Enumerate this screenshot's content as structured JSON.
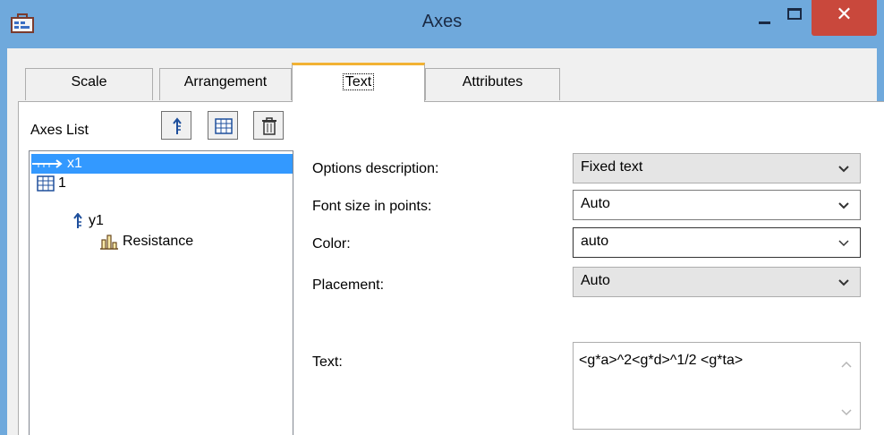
{
  "window": {
    "title": "Axes",
    "close_glyph": "✕"
  },
  "tabs": [
    {
      "label": "Scale"
    },
    {
      "label": "Arrangement"
    },
    {
      "label": "Text",
      "active": true
    },
    {
      "label": "Attributes"
    }
  ],
  "axes_list": {
    "label": "Axes List",
    "toolbar": [
      {
        "icon": "axis-y-icon"
      },
      {
        "icon": "grid-icon"
      },
      {
        "icon": "trash-icon"
      }
    ],
    "items": [
      {
        "label": "x1",
        "icon": "axis-x-icon",
        "selected": true
      },
      {
        "label": "1",
        "icon": "grid-icon"
      },
      {
        "label": "y1",
        "icon": "axis-y-icon"
      },
      {
        "label": "Resistance",
        "icon": "bar-chart-icon"
      }
    ]
  },
  "fields": {
    "options_description": {
      "label": "Options description:",
      "value": "Fixed text"
    },
    "font_size": {
      "label": "Font size in points:",
      "value": "Auto"
    },
    "color": {
      "label": "Color:",
      "value": "auto"
    },
    "placement": {
      "label": "Placement:",
      "value": "Auto"
    },
    "text": {
      "label": "Text:",
      "value": "<g*a>^2<g*d>^1/2 <g*ta>"
    }
  },
  "colors": {
    "title_bar": "#6fa9dc",
    "close_button": "#c9483c",
    "selection": "#3399ff",
    "active_tab_accent": "#f2b233"
  }
}
